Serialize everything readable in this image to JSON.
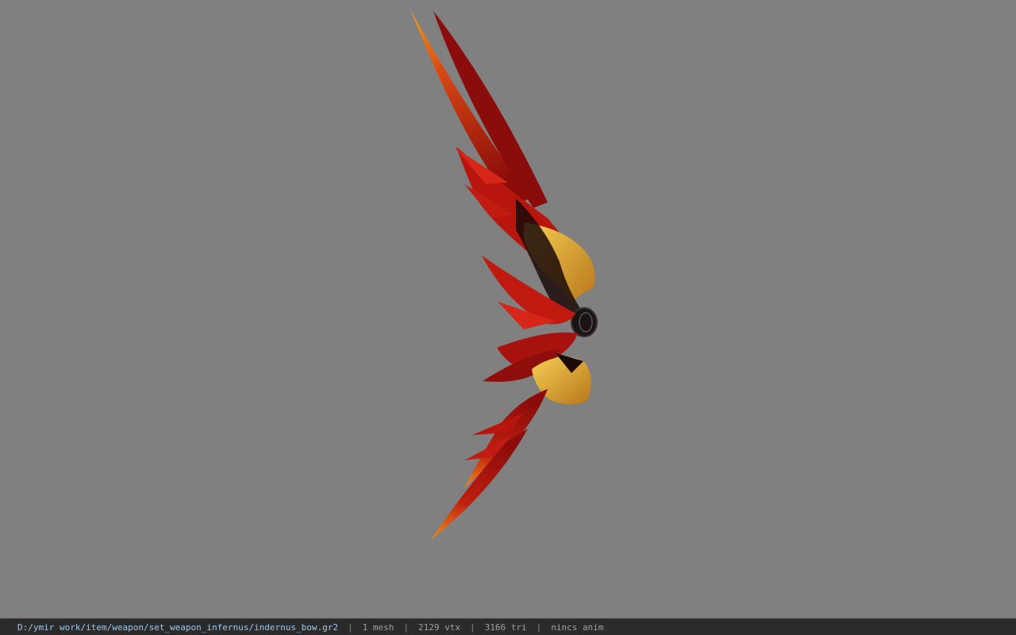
{
  "status_bar": {
    "file_path": "D:/ymir work/item/weapon/set_weapon_infernus/indernus_bow.gr2",
    "separator": "|",
    "mesh_count": "1 mesh",
    "vertex_count": "2129 vtx",
    "triangle_count": "3166 tri",
    "anim_info": "nincs anim"
  },
  "viewport": {
    "background_color": "#808080",
    "model_name": "infernus-bow"
  },
  "colors": {
    "deep_red": "#7a0a08",
    "red": "#b8150f",
    "bright_red": "#d6261a",
    "orange": "#e36a12",
    "gold": "#e3b23a",
    "dark": "#1a0a08"
  }
}
